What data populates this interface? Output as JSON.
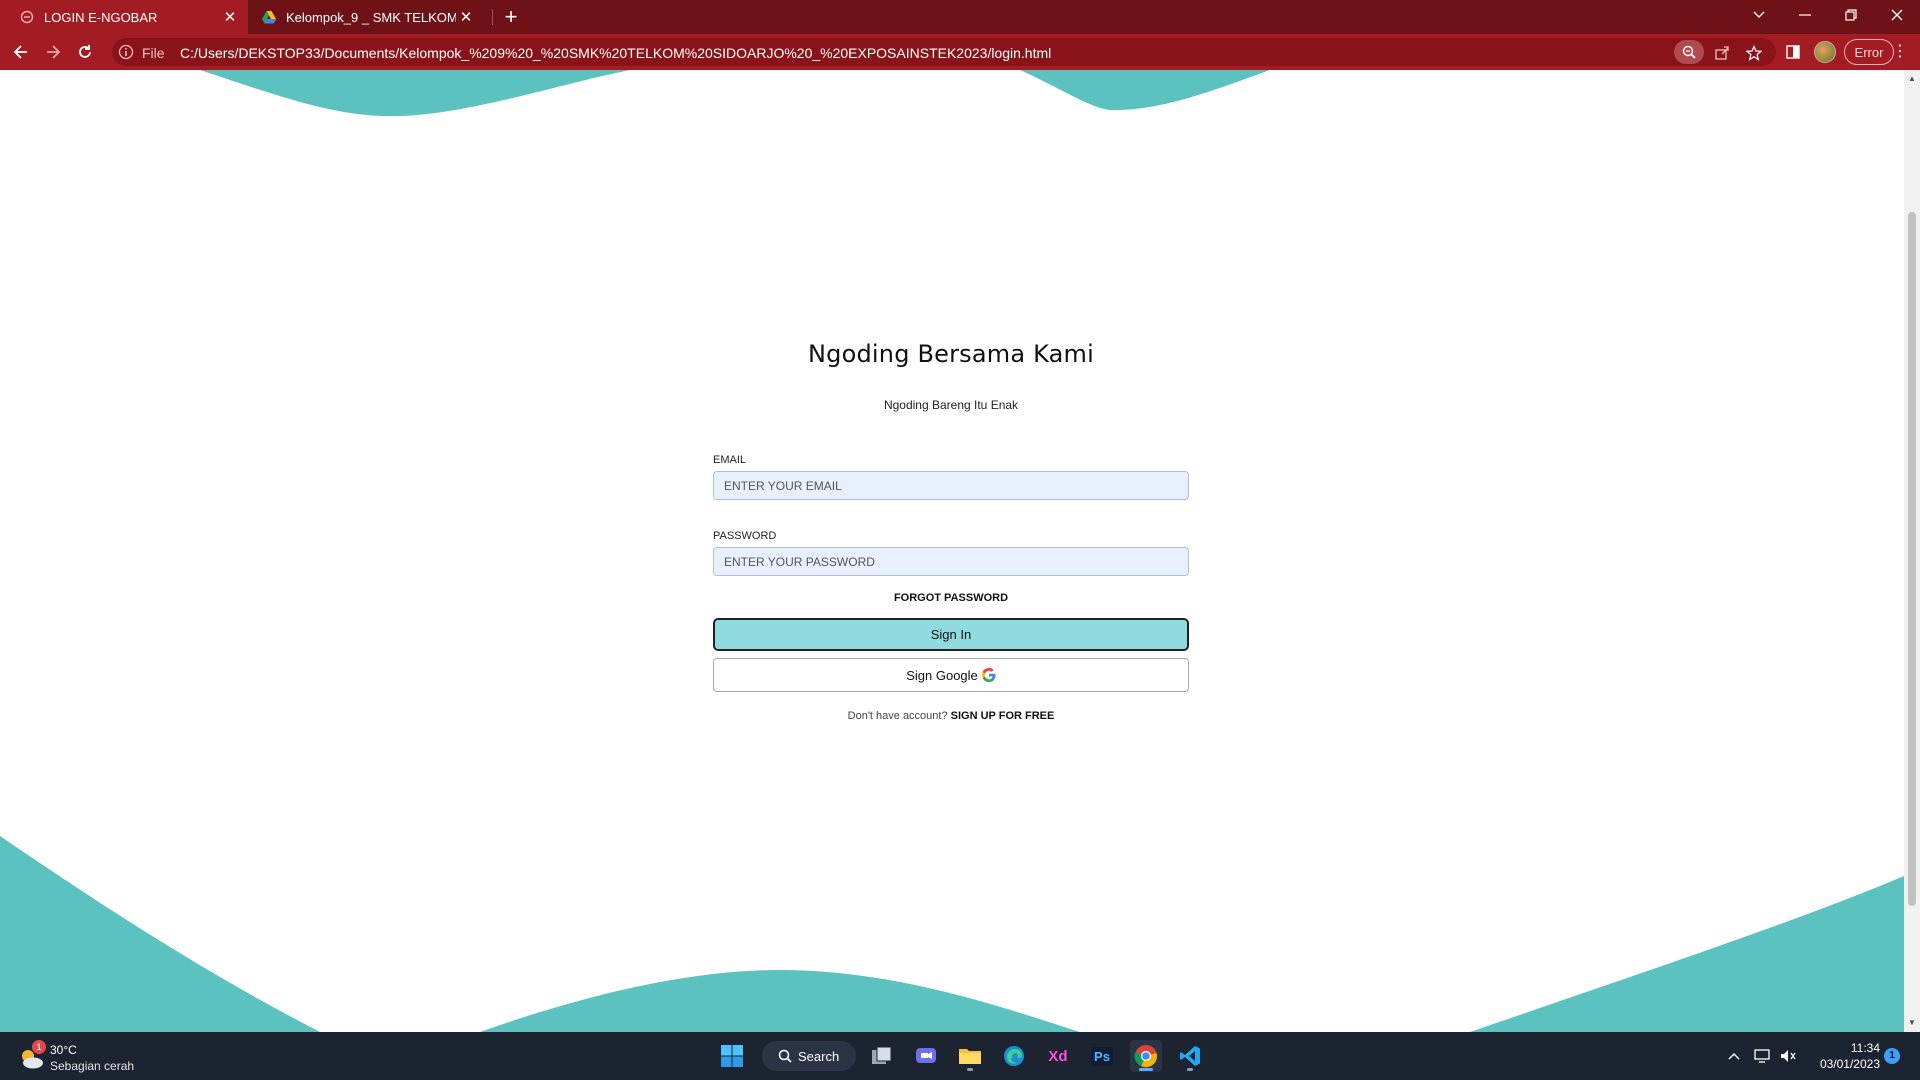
{
  "browser": {
    "tabs": [
      {
        "title": "LOGIN E-NGOBAR",
        "active": true
      },
      {
        "title": "Kelompok_9 _ SMK TELKOM SIDOARJO",
        "active": false
      }
    ],
    "address": {
      "scheme_label": "File",
      "url": "C:/Users/DEKSTOP33/Documents/Kelompok_%209%20_%20SMK%20TELKOM%20SIDOARJO%20_%20EXPOSAINSTEK2023/login.html"
    },
    "error_label": "Error",
    "theme": {
      "frame": "#6e1218",
      "toolbar": "#a31c24"
    }
  },
  "page": {
    "title": "Ngoding Bersama Kami",
    "subtitle": "Ngoding Bareng Itu Enak",
    "email_label": "EMAIL",
    "email_placeholder": "ENTER YOUR EMAIL",
    "password_label": "PASSWORD",
    "password_placeholder": "ENTER YOUR PASSWORD",
    "forgot_label": "FORGOT PASSWORD",
    "signin_label": "Sign In",
    "google_label": "Sign Google",
    "signup_prompt": "Don't have account?",
    "signup_link": "SIGN UP FOR FREE",
    "accent_color": "#5bc2bf",
    "signin_color": "#8fdbe0"
  },
  "taskbar": {
    "weather": {
      "temp": "30°C",
      "desc": "Sebagian cerah",
      "badge": "1"
    },
    "search_label": "Search",
    "apps": [
      "windows-start",
      "search",
      "task-view",
      "teams-chat",
      "file-explorer",
      "edge",
      "adobe-xd",
      "photoshop",
      "chrome",
      "vscode"
    ],
    "xd_label": "Xd",
    "ps_label": "Ps",
    "time": "11:34",
    "date": "03/01/2023",
    "notifications": "1"
  }
}
